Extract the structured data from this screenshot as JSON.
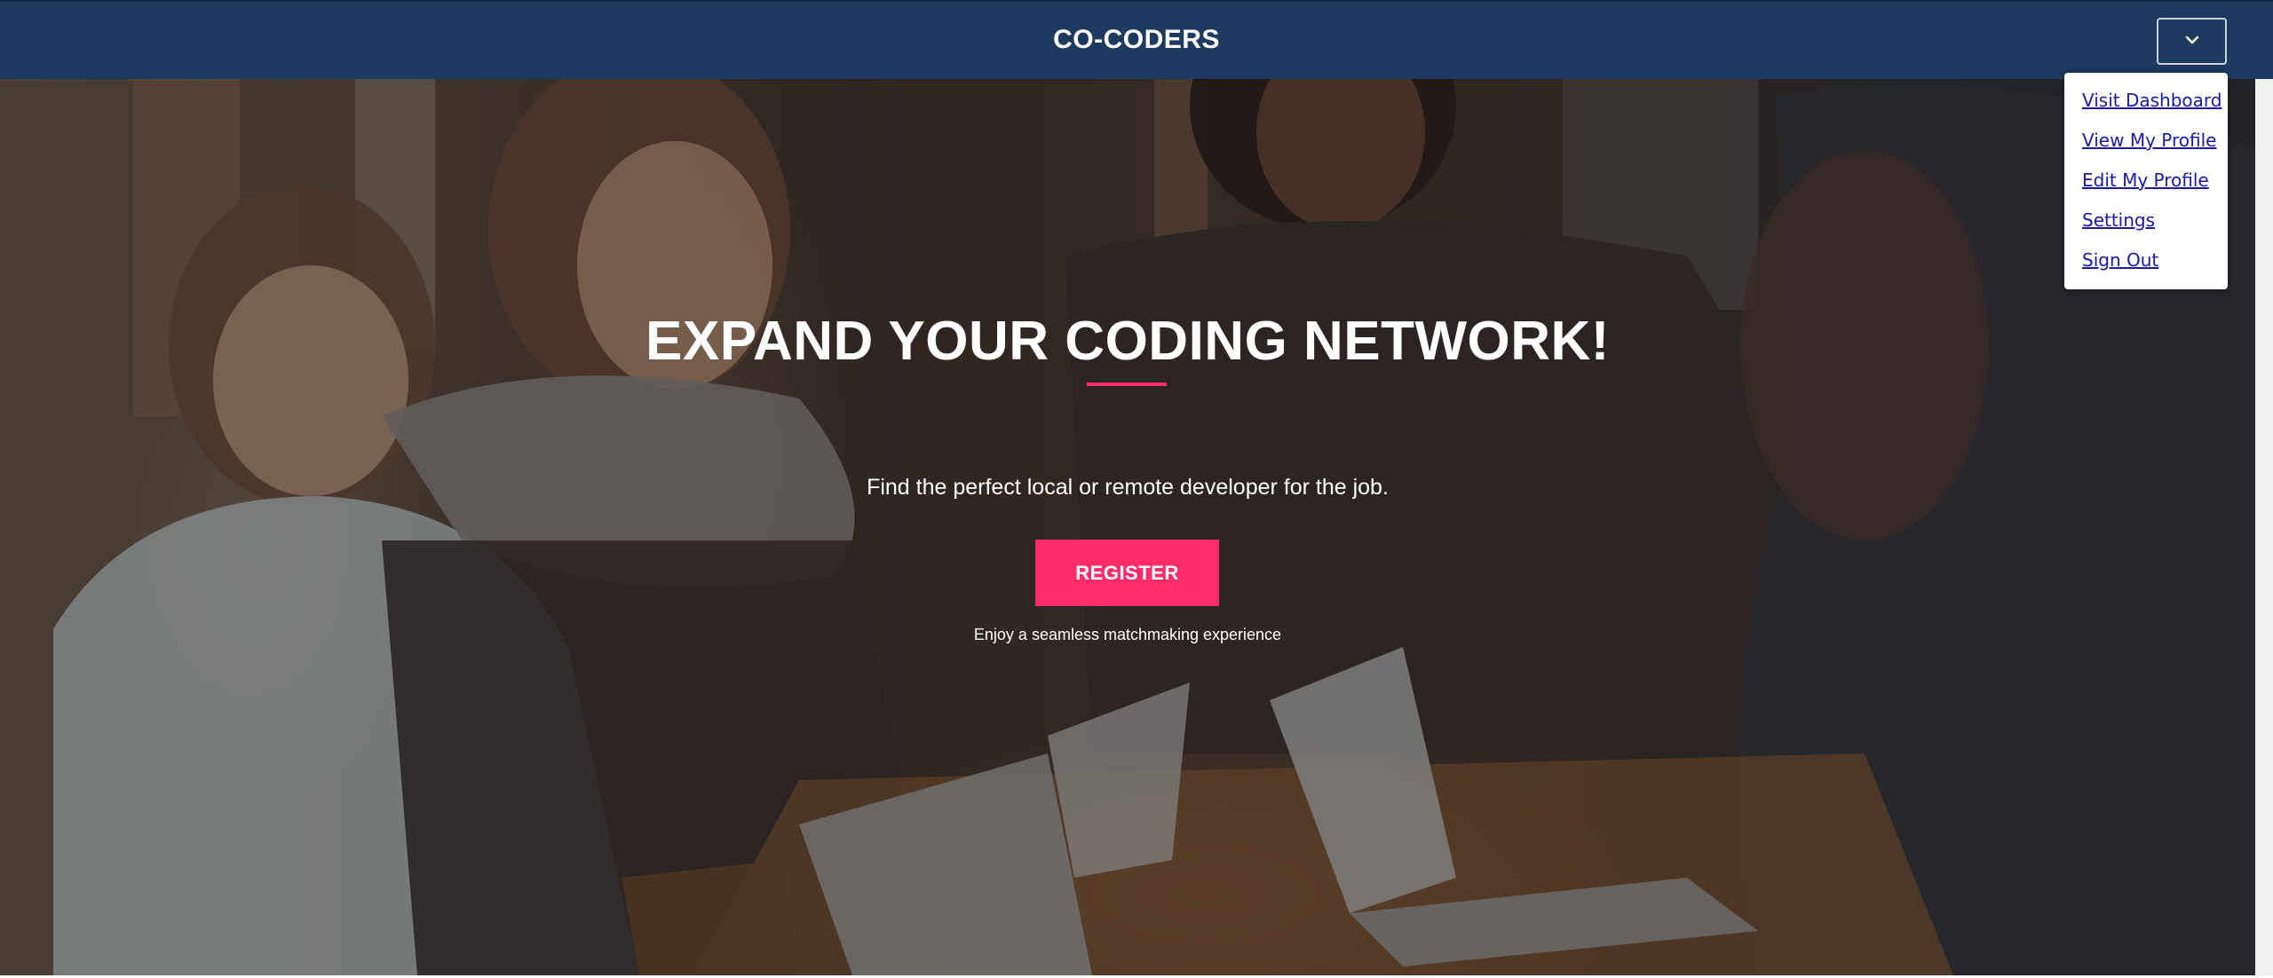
{
  "navbar": {
    "brand": "CO-CODERS",
    "toggle_icon": "chevron-down-icon"
  },
  "dropdown": {
    "items": [
      {
        "label": "Visit Dashboard"
      },
      {
        "label": "View My Profile"
      },
      {
        "label": "Edit My Profile"
      },
      {
        "label": "Settings"
      },
      {
        "label": "Sign Out"
      }
    ]
  },
  "hero": {
    "title": "EXPAND YOUR CODING NETWORK!",
    "subtitle": "Find the perfect local or remote developer for the job.",
    "register_label": "REGISTER",
    "tagline": "Enjoy a seamless matchmaking experience",
    "background": "photo of people working on laptops at a table"
  },
  "colors": {
    "navbar": "#1e3a5f",
    "accent": "#ff2c6a",
    "link": "#1a1aa6",
    "text_light": "#ffffff"
  }
}
